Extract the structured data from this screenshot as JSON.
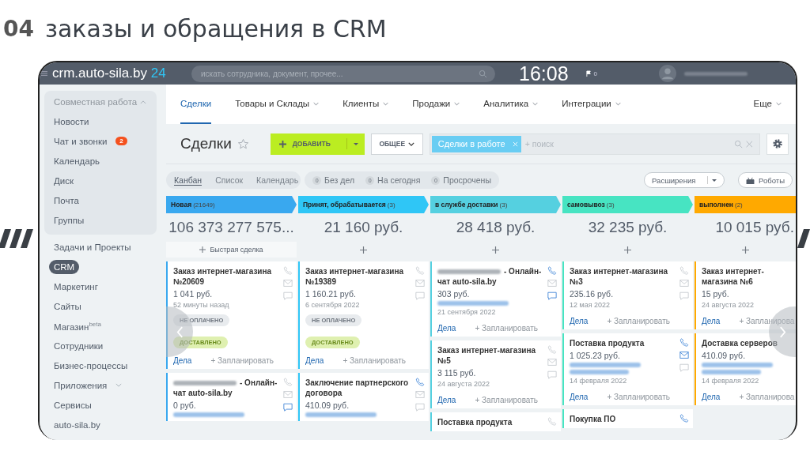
{
  "slide": {
    "number": "04",
    "title": "заказы и обращения в CRM"
  },
  "header": {
    "logo": "crm.auto-sila.by",
    "logo_suffix": "24",
    "search_placeholder": "искать сотрудника, документ, прочее...",
    "time": "16:08",
    "flag_count": "0"
  },
  "sidebar": {
    "group": {
      "label": "Совместная работа",
      "expanded": true,
      "items": [
        {
          "label": "Новости"
        },
        {
          "label": "Чат и звонки",
          "badge": "2"
        },
        {
          "label": "Календарь"
        },
        {
          "label": "Диск"
        },
        {
          "label": "Почта"
        },
        {
          "label": "Группы"
        }
      ]
    },
    "items": [
      {
        "label": "Задачи и Проекты",
        "selected": false,
        "dropdown": false
      },
      {
        "label": "CRM",
        "selected": true,
        "dropdown": false
      },
      {
        "label": "Маркетинг",
        "selected": false,
        "dropdown": false
      },
      {
        "label": "Сайты",
        "selected": false,
        "dropdown": false
      },
      {
        "label": "Магазин$^{beta}$",
        "selected": false,
        "dropdown": false
      },
      {
        "label": "Сотрудники",
        "selected": false,
        "dropdown": false
      },
      {
        "label": "Бизнес-процессы",
        "selected": false,
        "dropdown": false
      },
      {
        "label": "Приложения",
        "selected": false,
        "dropdown": true
      },
      {
        "label": "Сервисы",
        "selected": false,
        "dropdown": false
      },
      {
        "label": "auto-sila.by",
        "selected": false,
        "dropdown": false
      }
    ]
  },
  "nav": [
    {
      "label": "Сделки",
      "selected": true,
      "dropdown": false
    },
    {
      "label": "Товары и Склады",
      "selected": false,
      "dropdown": true
    },
    {
      "label": "Клиенты",
      "selected": false,
      "dropdown": true
    },
    {
      "label": "Продажи",
      "selected": false,
      "dropdown": true
    },
    {
      "label": "Аналитика",
      "selected": false,
      "dropdown": true
    },
    {
      "label": "Интеграции",
      "selected": false,
      "dropdown": true
    },
    {
      "label": "Еще",
      "selected": false,
      "dropdown": true
    }
  ],
  "toolbar": {
    "title": "Сделки",
    "add_button": "ДОБАВИТЬ",
    "filter_button": "ОБЩЕЕ",
    "filter_chip": "Сделки в работе",
    "search_placeholder": "+ поиск"
  },
  "views": [
    {
      "label": "Канбан",
      "selected": true
    },
    {
      "label": "Список",
      "selected": false
    },
    {
      "label": "Календарь",
      "selected": false
    }
  ],
  "counters": [
    {
      "count": "0",
      "label": "Без дел"
    },
    {
      "count": "0",
      "label": "На сегодня"
    },
    {
      "count": "0",
      "label": "Просрочены"
    }
  ],
  "actions": {
    "extensions": "Расширения",
    "robots": "Роботы"
  },
  "columns": [
    {
      "name": "Новая",
      "count": "(21649)",
      "color": "#39a8ef",
      "total": "106 373 277 575...",
      "quick_add": "Быстрая сделка",
      "cards": [
        {
          "title": "Заказ интернет-магазина №20609",
          "amount": "1 041 руб.",
          "date": "52 минуты назад",
          "tags": [
            {
              "label": "НЕ ОПЛАЧЕНО",
              "kind": "neutral"
            },
            {
              "label": "ДОСТАВЛЕНО",
              "kind": "success"
            }
          ],
          "icons": {
            "phone": false,
            "mail": false,
            "chat": false
          },
          "actions": [
            "Дела",
            "+ Запланировать"
          ]
        },
        {
          "title_redacted": true,
          "title": "- Онлайн-чат auto-sila.by",
          "amount": "0 руб.",
          "contact_redacted": true,
          "icons": {
            "phone": false,
            "mail": false,
            "chat": true
          }
        }
      ]
    },
    {
      "name": "Принят, обрабатывается",
      "count": "(3)",
      "color": "#2fc6f6",
      "total": "21 160 руб.",
      "cards": [
        {
          "title": "Заказ интернет-магазина №19389",
          "amount": "1 160.21 руб.",
          "date": "6 сентября 2022",
          "tags": [
            {
              "label": "НЕ ОПЛАЧЕНО",
              "kind": "neutral"
            },
            {
              "label": "ДОСТАВЛЕНО",
              "kind": "success"
            }
          ],
          "icons": {
            "phone": false,
            "mail": false,
            "chat": false
          },
          "actions": [
            "Дела",
            "+ Запланировать"
          ]
        },
        {
          "title": "Заключение партнерского договора",
          "amount": "410.09 руб.",
          "contact_redacted": true,
          "icons": {
            "phone": true,
            "mail": false,
            "chat": false
          }
        }
      ]
    },
    {
      "name": "в службе доставки",
      "count": "(3)",
      "color": "#55d0e0",
      "total": "28 418 руб.",
      "cards": [
        {
          "title_redacted": true,
          "title": "- Онлайн-чат auto-sila.by",
          "amount": "303 руб.",
          "contact_redacted": true,
          "date": "21 сентября 2022",
          "icons": {
            "phone": true,
            "mail": false,
            "chat": true
          },
          "actions": [
            "Дела",
            "+ Запланировать"
          ]
        },
        {
          "title": "Заказ интернет-магазина №5",
          "amount": "3 115 руб.",
          "date": "24 августа 2022",
          "icons": {
            "phone": false,
            "mail": false,
            "chat": false
          },
          "actions": [
            "Дела",
            "+ Запланировать"
          ]
        },
        {
          "title": "Поставка продукта",
          "icons": {
            "phone": false
          }
        }
      ]
    },
    {
      "name": "самовывоз",
      "count": "(3)",
      "color": "#47e4c2",
      "total": "32 235 руб.",
      "cards": [
        {
          "title": "Заказ интернет-магазина №3",
          "amount": "235.16 руб.",
          "date": "12 мая 2022",
          "icons": {
            "phone": false,
            "mail": false,
            "chat": false
          },
          "actions": [
            "Дела",
            "+ Запланировать"
          ]
        },
        {
          "title": "Поставка продукта",
          "amount": "1 025.23 руб.",
          "contact_redacted": true,
          "company_redacted": true,
          "date": "14 февраля 2022",
          "icons": {
            "phone": true,
            "mail": true,
            "chat": false
          },
          "actions": [
            "Дела",
            "+ Запланировать"
          ]
        },
        {
          "title": "Покупка ПО",
          "icons": {
            "phone": true
          }
        }
      ]
    },
    {
      "name": "выполнен",
      "count": "(2)",
      "color": "#ffa900",
      "total": "10 015 руб.",
      "cards": [
        {
          "title": "Заказ интернет-магазина №6",
          "amount": "15 руб.",
          "date": "24 августа 2022",
          "actions": [
            "Дела",
            "+ Запланирова"
          ]
        },
        {
          "title": "Доставка серверов",
          "amount": "410.09 руб.",
          "contact_redacted": true,
          "company_redacted": true,
          "date": "14 февраля 2022",
          "actions": [
            "Дела",
            "+ Запланирова"
          ]
        }
      ]
    }
  ]
}
